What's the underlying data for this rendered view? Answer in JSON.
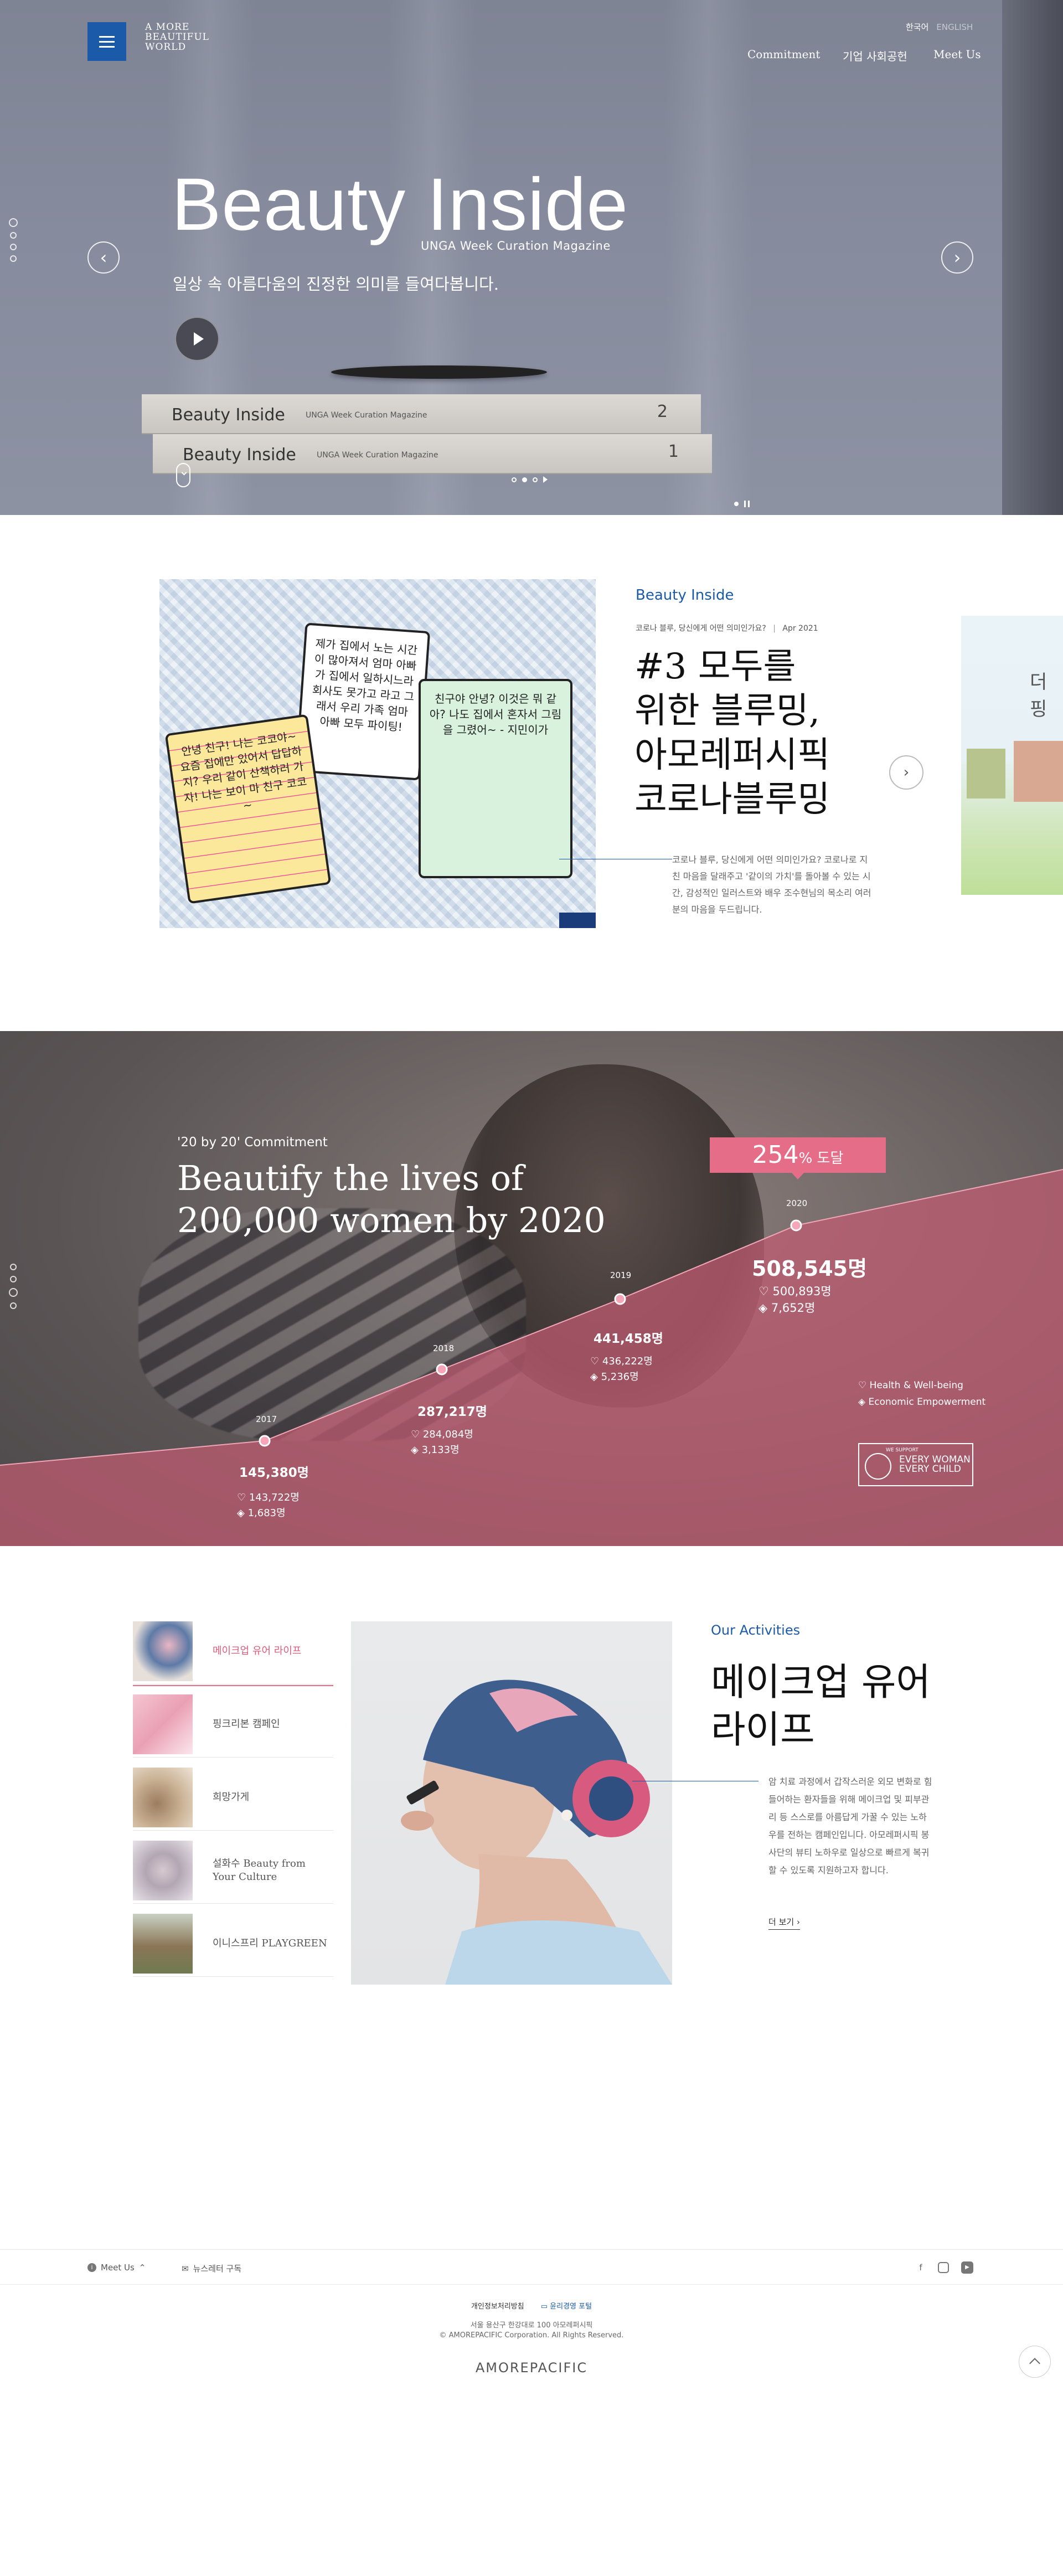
{
  "header": {
    "logo_text": "A MORE BEAUTIFUL WORLD",
    "lang_active": "한국어",
    "lang_other": "ENGLISH",
    "nav": [
      "Commitment",
      "기업 사회공헌",
      "Meet Us"
    ]
  },
  "hero": {
    "title": "Beauty Inside",
    "subtitle": "UNGA Week Curation Magazine",
    "description": "일상 속 아름다움의 진정한 의미를 들여다봅니다.",
    "book_title": "Beauty Inside",
    "book_subtitle": "UNGA Week Curation Magazine",
    "book_numbers": [
      "2",
      "1"
    ]
  },
  "magazine": {
    "category": "Beauty Inside",
    "meta": "코로나 블루, 당신에게 어떤 의미인가요?",
    "date": "Apr 2021",
    "title_lines": [
      "#3 모두를",
      "위한 블루밍,",
      "아모레퍼시픽",
      "코로나블루밍"
    ],
    "description": "코로나 블루, 당신에게 어떤 의미인가요? 코로나로 지친 마음을 달래주고 '같이의 가치'를 돌아볼 수 있는 시간, 감성적인 일러스트와 배우 조수현님의 목소리 여러분의 마음을 두드립니다.",
    "note1": "제가 집에서 노는 시간이 많아져서 엄마 아빠가 집에서 일하시느라 회사도 못가고 라고 그래서 우리 가족 엄마 아빠 모두 파이팅!",
    "note2": "안녕 친구! 나는 코코야~ 요즘 집에만 있어서 답답하지? 우리 같이 산책하러 가자! 나는 보이 마 친구 코코~",
    "note3": "친구야 안녕? 이것은 뭐 같아? 나도 집에서 혼자서 그림을 그렸어~ - 지민이가",
    "peek_text": "더 핑"
  },
  "commitment": {
    "kicker": "'20 by 20' Commitment",
    "title_lines": [
      "Beautify the lives of",
      "200,000 women by 2020"
    ],
    "badge_value": "254",
    "badge_unit": "% 도달",
    "legend": [
      "Health & Well-being",
      "Economic Empowerment"
    ],
    "ewec_small": "WE SUPPORT",
    "ewec_main": "EVERY WOMAN EVERY CHILD",
    "milestones": [
      {
        "year": "2017",
        "total": "145,380명",
        "health": "143,722명",
        "economic": "1,683명"
      },
      {
        "year": "2018",
        "total": "287,217명",
        "health": "284,084명",
        "economic": "3,133명"
      },
      {
        "year": "2019",
        "total": "441,458명",
        "health": "436,222명",
        "economic": "5,236명"
      },
      {
        "year": "2020",
        "total": "508,545명",
        "health": "500,893명",
        "economic": "7,652명"
      }
    ]
  },
  "activities": {
    "category": "Our Activities",
    "title_lines": [
      "메이크업 유어",
      "라이프"
    ],
    "description": "암 치료 과정에서 갑작스러운 외모 변화로 힘들어하는 환자들을 위해 메이크업 및 피부관리 등 스스로를 아름답게 가꿀 수 있는 노하우를 전하는 캠페인입니다. 아모레퍼시픽 봉사단의 뷰티 노하우로 일상으로 빠르게 복귀할 수 있도록 지원하고자 합니다.",
    "more": "더 보기",
    "items": [
      {
        "label": "메이크업 유어 라이프"
      },
      {
        "label": "핑크리본 캠페인"
      },
      {
        "label": "희망가게"
      },
      {
        "label": "설화수 Beauty from Your Culture"
      },
      {
        "label": "이니스프리 PLAYGREEN"
      }
    ]
  },
  "footer": {
    "meet_us": "Meet Us",
    "newsletter": "뉴스레터 구독",
    "privacy": "개인정보처리방침",
    "ethics": "윤리경영 포털",
    "address": "서울 용산구 한강대로 100 아모레퍼시픽",
    "copyright": "© AMOREPACIFIC Corporation. All Rights Reserved.",
    "brand": "AMOREPACIFIC",
    "sns": [
      "facebook-icon",
      "instagram-icon",
      "youtube-icon"
    ]
  },
  "colors": {
    "brand_blue": "#1a5aa8",
    "pink": "#e56d88",
    "area_fill": "#c25b72"
  }
}
